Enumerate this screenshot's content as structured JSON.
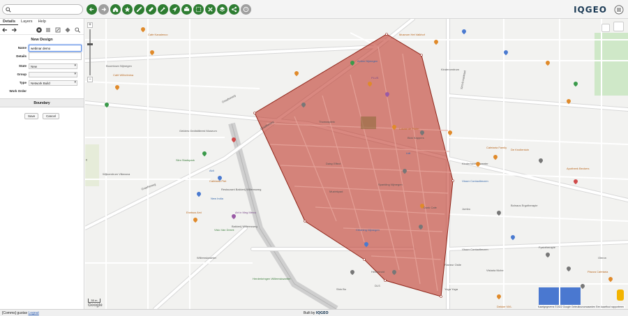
{
  "app": {
    "logo_text": "IQGEO",
    "brand_color": "#2e7d32",
    "search_icon": "search-icon"
  },
  "toolbar": {
    "buttons": [
      {
        "name": "back-button",
        "icon": "arrow-left-icon"
      },
      {
        "name": "forward-button",
        "icon": "arrow-right-icon",
        "disabled": true
      },
      {
        "name": "home-button",
        "icon": "home-icon"
      },
      {
        "name": "bookmark-button",
        "icon": "star-icon"
      },
      {
        "name": "link-button",
        "icon": "link-icon"
      },
      {
        "name": "measure-button",
        "icon": "ruler-icon"
      },
      {
        "name": "edit-button",
        "icon": "pencil-icon"
      },
      {
        "name": "navigate-button",
        "icon": "navigate-icon"
      },
      {
        "name": "print-button",
        "icon": "print-icon"
      },
      {
        "name": "select-button",
        "icon": "select-icon"
      },
      {
        "name": "tools-button",
        "icon": "tools-icon"
      },
      {
        "name": "layers-button",
        "icon": "layers-icon"
      },
      {
        "name": "share-button",
        "icon": "share-icon"
      },
      {
        "name": "help-button",
        "icon": "help-icon",
        "disabled": true
      }
    ]
  },
  "panel": {
    "tabs": [
      "Details",
      "Layers",
      "Help"
    ],
    "active_tab": "Details",
    "title": "New Design",
    "fields": {
      "name": {
        "label": "Name",
        "value": "webinar demo"
      },
      "details": {
        "label": "Details",
        "value": ""
      },
      "state": {
        "label": "State",
        "value": "New"
      },
      "group": {
        "label": "Group",
        "value": ""
      },
      "type": {
        "label": "Type",
        "value": "Network Build"
      },
      "work_order": {
        "label": "Work Order",
        "value": ""
      }
    },
    "boundary_label": "Boundary",
    "save_label": "Save",
    "cancel_label": "Cancel"
  },
  "map": {
    "boundary_color": "#c0392b",
    "labels": {
      "l1": "Graafseweg",
      "l2": "Graafseweg",
      "l3": "Sint Annastraat",
      "l4": "Graafseweg",
      "l5": "Museum Het Valkhof",
      "l6": "Cafe Kanalenco",
      "l7": "Boomtown Nijmegen",
      "l8": "Café Wilhelmina",
      "l9": "Action Nijmegen",
      "l10": "PLUS",
      "l11": "Thomasplein",
      "l12": "Lokaal de Pluim",
      "l13": "Blok Kappers",
      "l14": "Kinderhaven Tweeter",
      "l15": "Visser Contactlenzen",
      "l16": "Bolnaus Ergotherapie",
      "l17": "Jumbo",
      "l18": "Cafetaria Family",
      "l19": "De Knollentuin",
      "l20": "Apotheek Beckers",
      "l21": "Gelders Gedistilleerd Museum",
      "l22": "Cafetaria Piet",
      "l23": "Restaurant Bakkerij Willemsweg",
      "l24": "New India",
      "l25": "Erwtsus Arvi",
      "l26": "Bakkerij Willemsweg",
      "l27": "Art in Meg Mercs",
      "l28": "Visio Van Dremt",
      "l29": "Dunk Cafe",
      "l30": "Daisy Effect",
      "l31": "Muziekpad",
      "l32": "Cleaning Nijmegen",
      "l33": "Visser Contactlenzen",
      "l34": "Heidekruid",
      "l35": "Vistaria Niche",
      "l36": "Herderkringen Willemskwartier",
      "l37": "Dekker NVL",
      "l38": "Yoga Yoga",
      "l39": "Flaneur Ostle",
      "l40": "DLS",
      "l41": "Shin Bo",
      "l42": "Piazza Cafetaria",
      "l43": "Oleron",
      "l44": "Willemskwartier",
      "l45": "Wijkcentrum Villanova",
      "l46": "Aldi",
      "l47": "Lidl",
      "l48": "Slim Stadspark",
      "l49": "Kindercentrum",
      "l50": "Fysiotherapie",
      "l51": "Sparkling Nijmegen"
    },
    "scale_text": "50 m",
    "google_text": "Google",
    "attribution": "Kaartgegevens ©2022 Google  Gebruiksvoorwaarden  Een kaartfout rapporteren"
  },
  "status": {
    "user_prefix": "[Comms] gustav",
    "logout_label": "Logout",
    "built_by": "Built by",
    "built_by_brand": "IQGEO"
  }
}
